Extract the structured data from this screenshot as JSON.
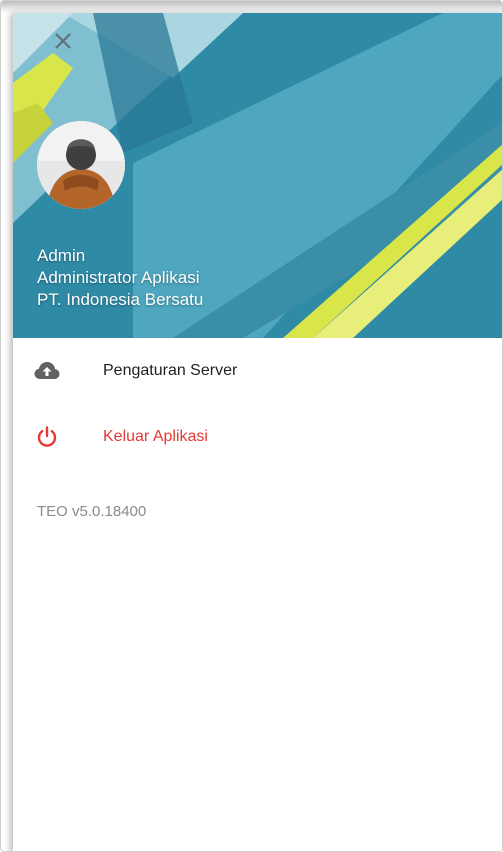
{
  "header": {
    "close_icon": "close-icon",
    "avatar_icon": "user-avatar",
    "user_name": "Admin",
    "user_role": "Administrator Aplikasi",
    "company": "PT. Indonesia Bersatu",
    "colors": {
      "base": "#2f8aa6",
      "light": "#8cc8d6",
      "accent": "#d8e64a"
    }
  },
  "menu": {
    "items": [
      {
        "icon": "cloud-upload-icon",
        "label": "Pengaturan Server",
        "color": "#212121"
      },
      {
        "icon": "power-icon",
        "label": "Keluar Aplikasi",
        "color": "#e53935"
      }
    ]
  },
  "footer": {
    "version": "TEO v5.0.18400"
  }
}
